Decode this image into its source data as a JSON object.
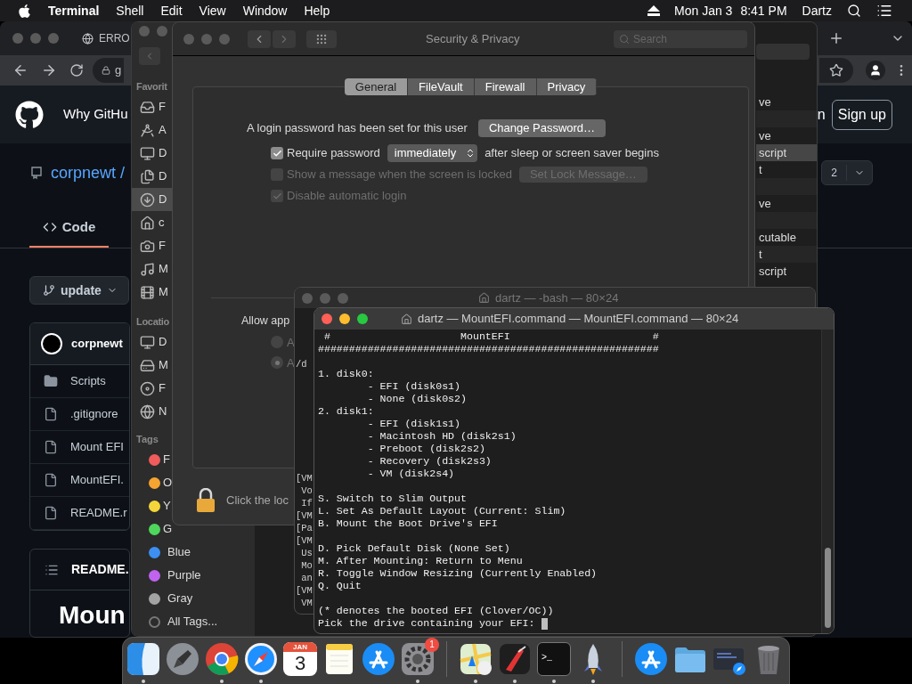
{
  "menu_bar": {
    "app": "Terminal",
    "menus": [
      "Shell",
      "Edit",
      "View",
      "Window",
      "Help"
    ],
    "date": "Mon Jan 3",
    "time": "8:41 PM",
    "user": "Dartz"
  },
  "browser": {
    "tab_title": "ERRO",
    "address": "g",
    "nav_link": "Why GitHu",
    "sign_in": "n",
    "sign_up": "Sign up",
    "repo_owner": "corpnewt /",
    "tabs": [
      {
        "label": "Code",
        "selected": true
      }
    ],
    "branch": "update",
    "count": "2",
    "commit_author": "corpnewt",
    "files": [
      {
        "name": "Scripts",
        "kind": "folder"
      },
      {
        "name": ".gitignore",
        "kind": "file"
      },
      {
        "name": "Mount EFI",
        "kind": "file"
      },
      {
        "name": "MountEFI.",
        "kind": "file"
      },
      {
        "name": "README.r",
        "kind": "file"
      }
    ],
    "readme_title": "README.",
    "readme_heading": "Moun"
  },
  "finder": {
    "sections": [
      {
        "title": "Favorit",
        "items": [
          {
            "label": "F",
            "selected": false
          },
          {
            "label": "A",
            "selected": false
          },
          {
            "label": "D",
            "selected": false
          },
          {
            "label": "D",
            "selected": false
          },
          {
            "label": "D",
            "selected": true
          },
          {
            "label": "c",
            "selected": false
          },
          {
            "label": "F",
            "selected": false
          },
          {
            "label": "M",
            "selected": false
          },
          {
            "label": "M",
            "selected": false
          }
        ]
      },
      {
        "title": "Locatio",
        "items": [
          {
            "label": "D",
            "selected": false
          },
          {
            "label": "M",
            "selected": false
          },
          {
            "label": "F",
            "selected": false
          },
          {
            "label": "N",
            "selected": false
          }
        ]
      }
    ],
    "tags_title": "Tags",
    "tags": [
      {
        "label": "F",
        "kind": "tag",
        "color": "#f05b5b"
      },
      {
        "label": "O",
        "kind": "tag",
        "color": "#f5a431"
      },
      {
        "label": "Y",
        "kind": "tag",
        "color": "#f4d63a"
      },
      {
        "label": "G",
        "kind": "tag",
        "color": "#4fd65c"
      },
      {
        "label": "Blue",
        "kind": "tag",
        "color": "#3d8ff2"
      },
      {
        "label": "Purple",
        "kind": "tag",
        "color": "#c063ef"
      },
      {
        "label": "Gray",
        "kind": "tag",
        "color": "#a3a3a3"
      },
      {
        "label": "All Tags...",
        "kind": "all"
      }
    ],
    "rows": [
      {
        "text": "ve",
        "selected": false
      },
      {
        "selected": false
      },
      {
        "text": "ve",
        "selected": false
      },
      {
        "text": "script",
        "selected": true
      },
      {
        "text": "t",
        "selected": false
      },
      {
        "selected": false
      },
      {
        "text": "ve",
        "selected": false
      },
      {
        "selected": false
      },
      {
        "text": "cutable",
        "selected": false
      },
      {
        "text": "t",
        "selected": false
      },
      {
        "text": "script",
        "selected": false
      }
    ]
  },
  "security": {
    "title": "Security & Privacy",
    "search_placeholder": "Search",
    "tabs": [
      {
        "label": "General",
        "selected": true
      },
      {
        "label": "FileVault",
        "selected": false
      },
      {
        "label": "Firewall",
        "selected": false
      },
      {
        "label": "Privacy",
        "selected": false
      }
    ],
    "password_text": "A login password has been set for this user",
    "change_password": "Change Password…",
    "options": [
      {
        "label": "Require password",
        "checked": true,
        "disabled": false,
        "select": "immediately",
        "suffix": "after sleep or screen saver begins"
      },
      {
        "label": "Show a message when the screen is locked",
        "checked": false,
        "disabled": true,
        "button": "Set Lock Message…"
      },
      {
        "label": "Disable automatic login",
        "checked": true,
        "disabled": true
      }
    ],
    "allow_label": "Allow app",
    "radios": [
      {
        "label": "A",
        "selected": false
      },
      {
        "label": "A",
        "selected": true
      }
    ],
    "lock_text": "Click the loc"
  },
  "terminal_back": {
    "title": "dartz — -bash — 80×24",
    "peek_blocks": [
      [
        "/d"
      ],
      [
        "[VM",
        " Vo",
        " If",
        "[VM",
        "[Pa",
        "[VM",
        " Us",
        " Mo",
        " an",
        "[VM",
        " VM"
      ]
    ]
  },
  "terminal_front": {
    "title": "dartz — MountEFI.command — MountEFI.command — 80×24",
    "blocks": [
      [
        " #                     MountEFI                       #",
        "#######################################################"
      ],
      [
        "1. disk0:",
        "        - EFI (disk0s1)",
        "        - None (disk0s2)",
        "2. disk1:",
        "        - EFI (disk1s1)",
        "        - Macintosh HD (disk2s1)",
        "        - Preboot (disk2s2)",
        "        - Recovery (disk2s3)",
        "        - VM (disk2s4)"
      ],
      [
        "S. Switch to Slim Output",
        "L. Set As Default Layout (Current: Slim)",
        "B. Mount the Boot Drive's EFI"
      ],
      [
        "D. Pick Default Disk (None Set)",
        "M. After Mounting: Return to Menu",
        "R. Toggle Window Resizing (Currently Enabled)",
        "Q. Quit"
      ],
      [
        "(* denotes the booted EFI (Clover/OC))",
        "Pick the drive containing your EFI:"
      ]
    ],
    "cursor": true
  },
  "dock": {
    "groups": [
      [
        {
          "kind": "finder",
          "running": true
        },
        {
          "kind": "launchpad",
          "running": false
        },
        {
          "kind": "chrome",
          "running": true
        },
        {
          "kind": "safari",
          "running": true
        },
        {
          "kind": "calendar",
          "month": "JAN",
          "day": "3",
          "running": false
        },
        {
          "kind": "notes",
          "running": false
        },
        {
          "kind": "appstore",
          "running": false
        },
        {
          "kind": "settings",
          "badge": "1",
          "running": true
        }
      ],
      [
        {
          "kind": "maps",
          "running": true
        },
        {
          "kind": "knife",
          "running": true
        },
        {
          "kind": "terminal",
          "prompt": ">_",
          "running": true
        },
        {
          "kind": "rocket",
          "running": true
        }
      ],
      [
        {
          "kind": "appstore",
          "running": false
        },
        {
          "kind": "folder",
          "running": false
        },
        {
          "kind": "screenshot",
          "running": false
        },
        {
          "kind": "trash",
          "running": false
        }
      ]
    ]
  }
}
